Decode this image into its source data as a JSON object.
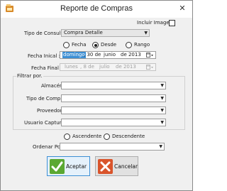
{
  "window": {
    "title": "Reporte de Compras",
    "close_glyph": "✕"
  },
  "options": {
    "incluir_imagen_label": "Incluir Imagen",
    "incluir_imagen_checked": false
  },
  "consulta": {
    "label": "Tipo de Consulta",
    "value": "Compra Detalle"
  },
  "date_mode": {
    "options": [
      "Fecha",
      "Desde",
      "Rango"
    ],
    "selected": "Desde"
  },
  "fecha_inicial": {
    "label": "Fecha Inical :",
    "weekday": "domingo",
    "day": ", 30 de",
    "month": "junio",
    "year": "de 2013"
  },
  "fecha_final": {
    "label": "Fecha Final",
    "weekday": "lunes",
    "day": ", 8 de",
    "month": "julio",
    "year": "de 2013"
  },
  "filtrar": {
    "title": "Filtrar por.",
    "fields": [
      {
        "label": "Almacén",
        "value": ""
      },
      {
        "label": "Tipo de Compra",
        "value": ""
      },
      {
        "label": "Proveedor",
        "value": ""
      },
      {
        "label": "Usuario Capturó",
        "value": ""
      }
    ]
  },
  "orden": {
    "ascendente_label": "Ascendente",
    "descendente_label": "Descendente",
    "selected": "none",
    "ordenar_label": "Ordenar Por",
    "ordenar_value": ""
  },
  "buttons": {
    "aceptar_label": "Aceptar",
    "cancelar_label": "Cancelar"
  },
  "colors": {
    "accept_green": "#5aa832",
    "cancel_red": "#d9542b",
    "focus_blue": "#3d8fd4"
  }
}
